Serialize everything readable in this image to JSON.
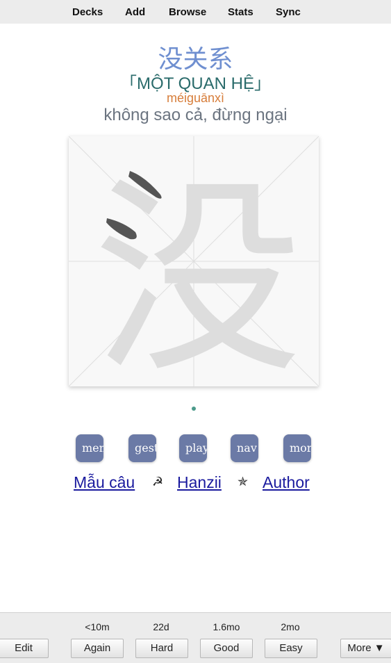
{
  "topbar": {
    "items": [
      "Decks",
      "Add",
      "Browse",
      "Stats",
      "Sync"
    ]
  },
  "card": {
    "hanzi": "没关系",
    "sino_vietnamese": "「MỘT QUAN HỆ」",
    "pinyin": "méiguānxì",
    "meaning": "không sao cả, đừng ngại",
    "stroke_character": "没",
    "buttons": [
      "men",
      "gest",
      "play",
      "nav",
      "mor"
    ],
    "links": {
      "sentence": "Mẫu câu",
      "hanzii": "Hanzii",
      "author": "Author",
      "sep1": "☭",
      "sep2": "✯"
    }
  },
  "reviewer": {
    "edit_label": "Edit",
    "more_label": "More ▼",
    "answers": [
      {
        "label": "Again",
        "due": "<10m"
      },
      {
        "label": "Hard",
        "due": "22d"
      },
      {
        "label": "Good",
        "due": "1.6mo"
      },
      {
        "label": "Easy",
        "due": "2mo"
      }
    ]
  }
}
